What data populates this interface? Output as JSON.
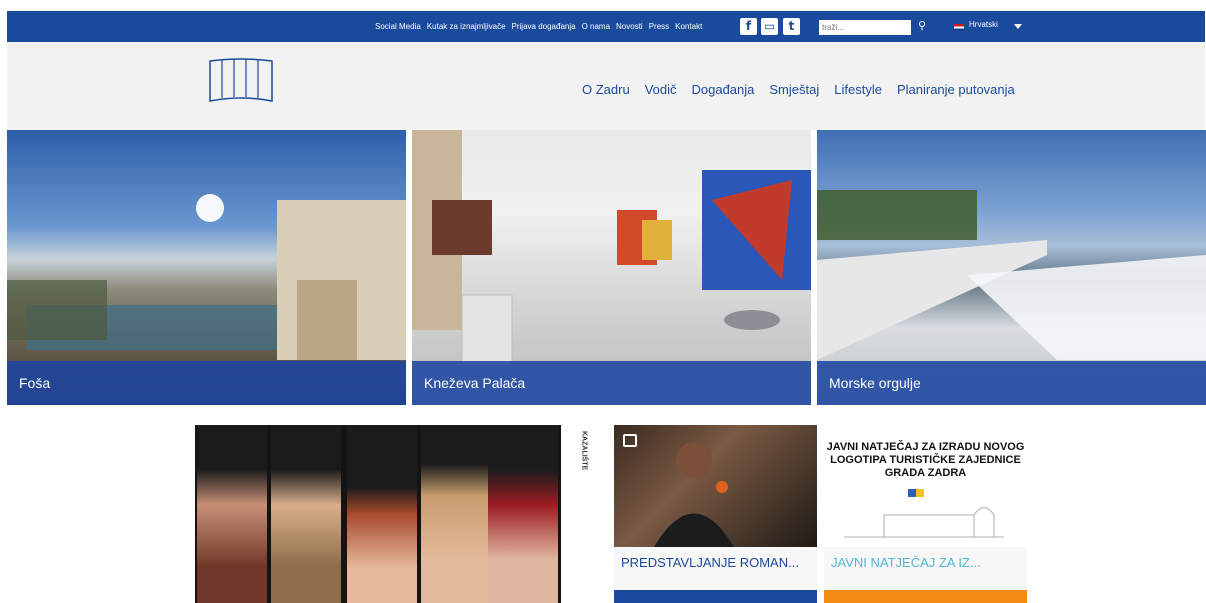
{
  "topbar": {
    "links": [
      "Social Media",
      "Kutak za iznajmljivače",
      "Prijava događanja",
      "O nama",
      "Novosti",
      "Press",
      "Kontakt"
    ],
    "search_placeholder": "traži...",
    "language": "Hrvatski",
    "social_icons": [
      "facebook-icon",
      "youtube-icon",
      "twitter-icon"
    ]
  },
  "nav": {
    "items": [
      "O Zadru",
      "Vodič",
      "Događanja",
      "Smještaj",
      "Lifestyle",
      "Planiranje putovanja"
    ]
  },
  "tiles": [
    {
      "caption": "Foša"
    },
    {
      "caption": "Kneževa Palača"
    },
    {
      "caption": "Morske orgulje"
    }
  ],
  "cards": {
    "poster_side_text": "KAZALIŠTE",
    "news1_title": "PREDSTAVLJANJE ROMAN...",
    "news2_headline": "JAVNI NATJEČAJ ZA IZRADU NOVOG LOGOTIPA TURISTIČKE ZAJEDNICE GRADA ZADRA",
    "news2_title": "JAVNI NATJEČAJ ZA IZ..."
  },
  "colors": {
    "brand_blue": "#1a4a9c",
    "accent_orange": "#f28b12",
    "accent_cyan": "#52b8d1"
  }
}
